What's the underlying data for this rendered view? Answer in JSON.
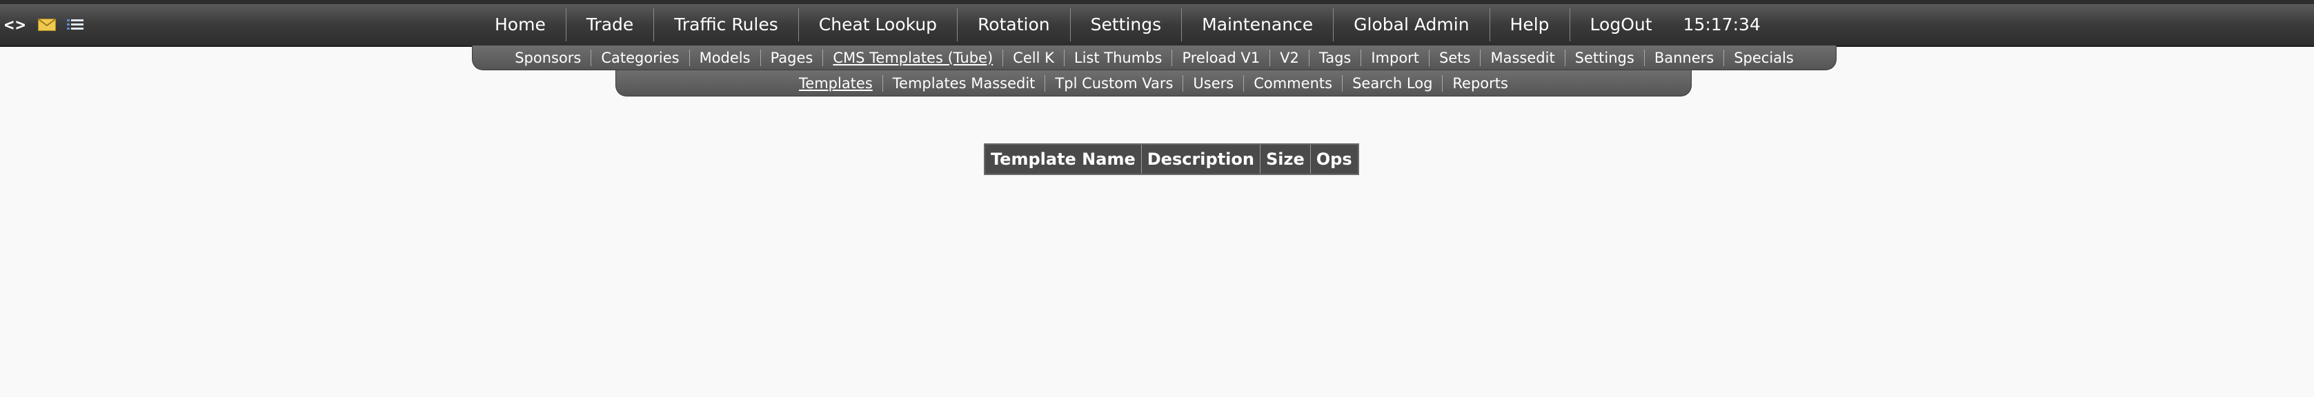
{
  "toolbar": {
    "code_icon_text": "<>",
    "icons": [
      "code-icon",
      "mail-icon",
      "list-icon"
    ]
  },
  "main_nav": {
    "items": [
      "Home",
      "Trade",
      "Traffic Rules",
      "Cheat Lookup",
      "Rotation",
      "Settings",
      "Maintenance",
      "Global Admin",
      "Help",
      "LogOut"
    ],
    "clock": "15:17:34"
  },
  "sub_nav": {
    "items": [
      "Sponsors",
      "Categories",
      "Models",
      "Pages",
      "CMS Templates (Tube)",
      "Cell K",
      "List Thumbs",
      "Preload V1",
      "V2",
      "Tags",
      "Import",
      "Sets",
      "Massedit",
      "Settings",
      "Banners",
      "Specials"
    ],
    "active": "CMS Templates (Tube)"
  },
  "section_nav": {
    "items": [
      "Templates",
      "Templates Massedit",
      "Tpl Custom Vars",
      "Users",
      "Comments",
      "Search Log",
      "Reports"
    ],
    "active": "Templates"
  },
  "table": {
    "headers": [
      "Template Name",
      "Description",
      "Size",
      "Ops"
    ]
  },
  "colors": {
    "page_bg": "#f9f9f9",
    "bar_dark": "#2e2e2e",
    "subnav_bg": "#5f5f5f",
    "table_header_bg": "#4a4a4a",
    "text_light": "#ffffff"
  }
}
